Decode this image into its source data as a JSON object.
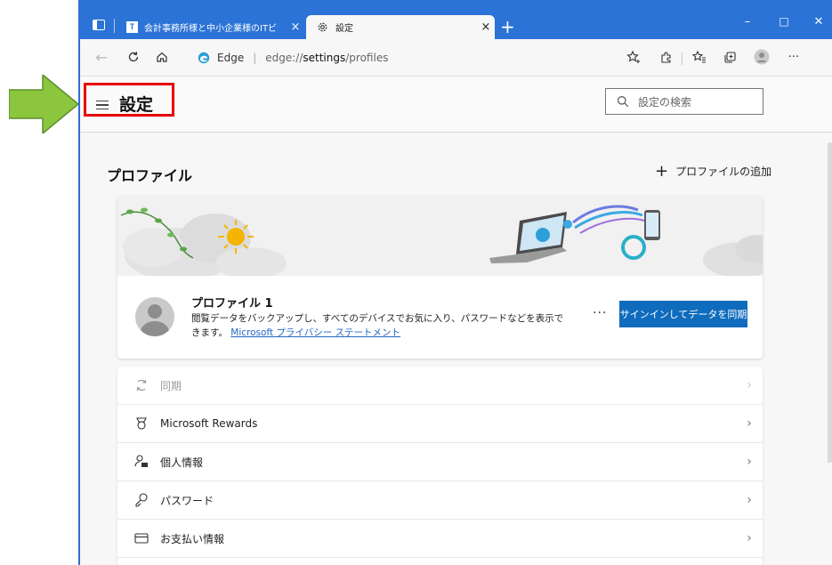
{
  "browser": {
    "tabs": [
      {
        "title": "会計事務所様と中小企業様のITビ",
        "close": "×"
      },
      {
        "title": "設定",
        "close": "×"
      }
    ],
    "new_tab": "+",
    "window_controls": {
      "minimize": "–",
      "maximize": "□",
      "close": "✕"
    },
    "address": {
      "site": "Edge",
      "separator": "|",
      "url_prefix": "edge://",
      "url_path": "settings",
      "url_suffix": "/profiles"
    },
    "accent_color": "#2b73d6"
  },
  "header": {
    "title": "設定",
    "search_placeholder": "設定の検索"
  },
  "section": {
    "title": "プロファイル",
    "add_label": "プロファイルの追加",
    "add_icon": "+"
  },
  "profile": {
    "name": "プロファイル 1",
    "description": "閲覧データをバックアップし、すべてのデバイスでお気に入り、パスワードなどを表示できます。",
    "privacy_link": "Microsoft プライバシー ステートメント",
    "more": "···",
    "sync_button": "サインインしてデータを同期"
  },
  "list": [
    {
      "label": "同期",
      "icon": "sync-icon",
      "disabled": true
    },
    {
      "label": "Microsoft Rewards",
      "icon": "rewards-icon",
      "disabled": false
    },
    {
      "label": "個人情報",
      "icon": "personal-info-icon",
      "disabled": false
    },
    {
      "label": "パスワード",
      "icon": "key-icon",
      "disabled": false
    },
    {
      "label": "お支払い情報",
      "icon": "card-icon",
      "disabled": false
    }
  ],
  "list_chevron": "›",
  "annotation_colors": {
    "arrow": "#8cc63f",
    "highlight_box": "#e60000"
  }
}
